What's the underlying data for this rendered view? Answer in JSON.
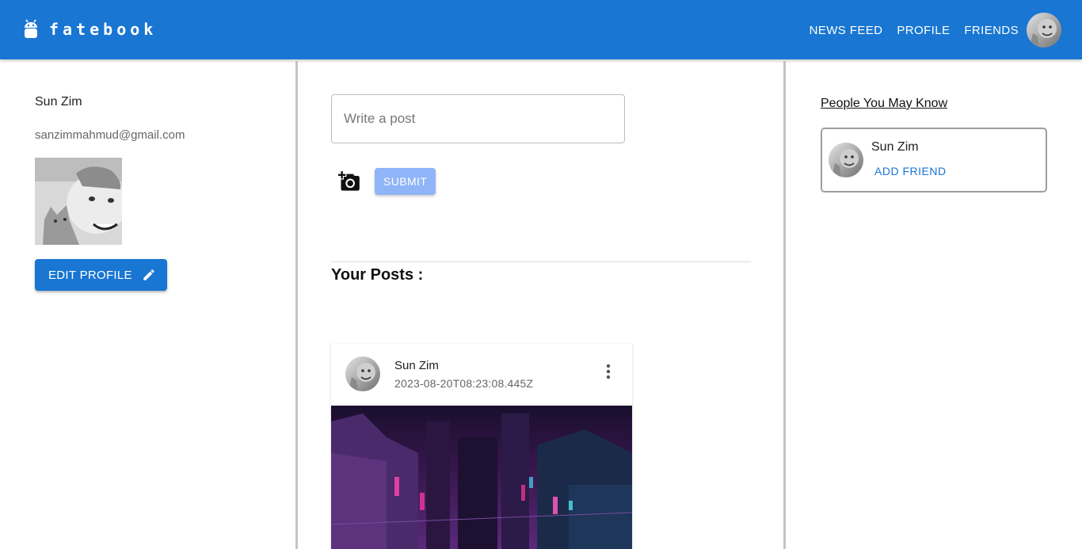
{
  "app": {
    "brand_name": "fatebook",
    "brand_icon": "android-icon",
    "accent_color": "#1976d2"
  },
  "nav": {
    "items": [
      "NEWS FEED",
      "PROFILE",
      "FRIENDS"
    ]
  },
  "profile": {
    "name": "Sun Zim",
    "email": "sanzimmahmud@gmail.com",
    "edit_label": "EDIT PROFILE"
  },
  "composer": {
    "placeholder": "Write a post",
    "submit_label": "SUBMIT"
  },
  "posts_section": {
    "title": "Your Posts :",
    "posts": [
      {
        "author": "Sun Zim",
        "timestamp": "2023-08-20T08:23:08.445Z"
      }
    ]
  },
  "suggestions": {
    "title": "People You May Know",
    "people": [
      {
        "name": "Sun Zim",
        "action_label": "ADD FRIEND"
      }
    ]
  }
}
